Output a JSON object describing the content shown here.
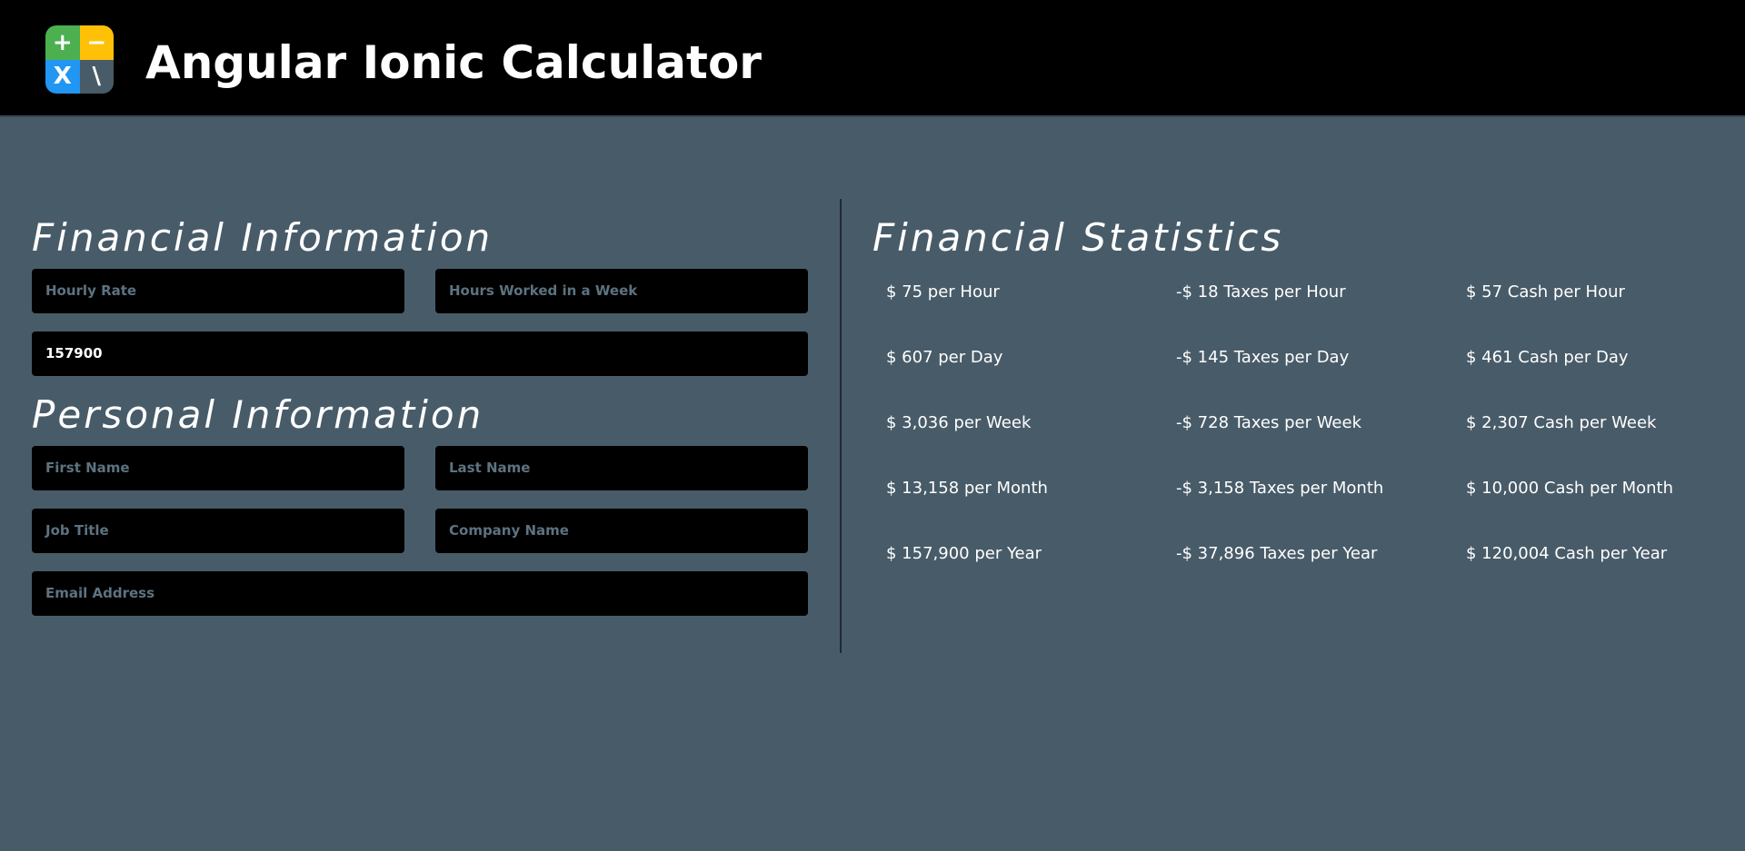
{
  "header": {
    "title": "Angular Ionic Calculator",
    "logo": {
      "plus": "+",
      "minus": "−",
      "times": "X",
      "divide": "\\",
      "colors": {
        "plus": "#4caf50",
        "minus": "#ffc107",
        "times": "#2196f3",
        "divide": "#485b68"
      }
    }
  },
  "financial_info": {
    "title": "Financial Information",
    "hourly_rate_placeholder": "Hourly Rate",
    "hours_worked_placeholder": "Hours Worked in a Week",
    "annual_value": "157900"
  },
  "personal_info": {
    "title": "Personal Information",
    "first_name_placeholder": "First Name",
    "last_name_placeholder": "Last Name",
    "job_title_placeholder": "Job Title",
    "company_name_placeholder": "Company Name",
    "email_placeholder": "Email Address"
  },
  "stats": {
    "title": "Financial Statistics",
    "rows": [
      {
        "gross": "$ 75 per Hour",
        "taxes": "-$ 18 Taxes per Hour",
        "cash": "$ 57 Cash per Hour"
      },
      {
        "gross": "$ 607 per Day",
        "taxes": "-$ 145 Taxes per Day",
        "cash": "$ 461 Cash per Day"
      },
      {
        "gross": "$ 3,036 per Week",
        "taxes": "-$ 728 Taxes per Week",
        "cash": "$ 2,307 Cash per Week"
      },
      {
        "gross": "$ 13,158 per Month",
        "taxes": "-$ 3,158 Taxes per Month",
        "cash": "$ 10,000 Cash per Month"
      },
      {
        "gross": "$ 157,900 per Year",
        "taxes": "-$ 37,896 Taxes per Year",
        "cash": "$ 120,004 Cash per Year"
      }
    ]
  },
  "colors": {
    "background": "#485b68",
    "header": "#000000",
    "field": "#000000",
    "placeholder": "#5d7280",
    "text": "#ffffff"
  }
}
